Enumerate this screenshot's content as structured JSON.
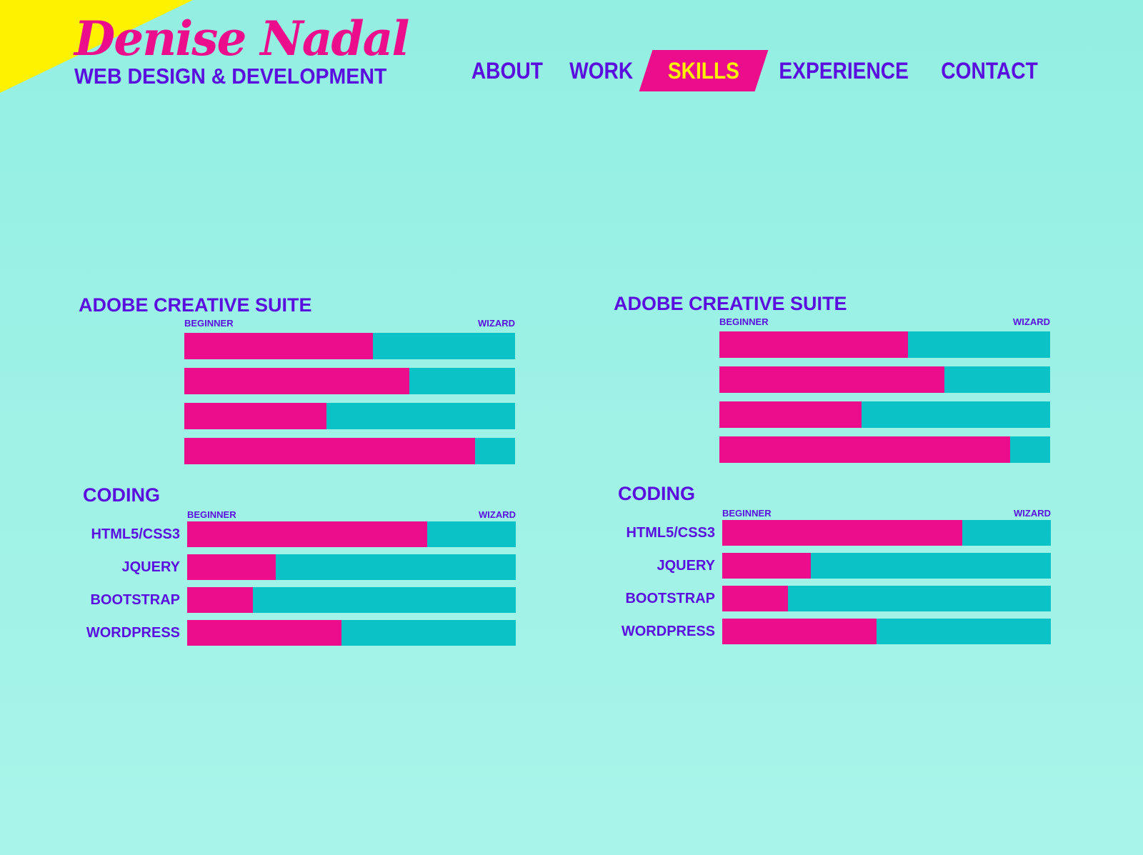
{
  "brand": {
    "name": "Denise Nadal",
    "tagline": "WEB DESIGN & DEVELOPMENT"
  },
  "nav": [
    {
      "label": "ABOUT",
      "active": false
    },
    {
      "label": "WORK",
      "active": false
    },
    {
      "label": "SKILLS",
      "active": true
    },
    {
      "label": "EXPERIENCE",
      "active": false
    },
    {
      "label": "CONTACT",
      "active": false
    }
  ],
  "colors": {
    "background": "#9ff1e6",
    "accent": "#ec0d8c",
    "text": "#5a0fde",
    "bar_track": "#0bc2c6",
    "highlight": "#fff200"
  },
  "panels": [
    {
      "adobe": {
        "title": "ADOBE CREATIVE SUITE",
        "scale_low": "BEGINNER",
        "scale_high": "WIZARD",
        "levels_percent": [
          57,
          68,
          43,
          88
        ]
      },
      "coding": {
        "title": "CODING",
        "scale_low": "BEGINNER",
        "scale_high": "WIZARD",
        "skills": [
          {
            "label": "HTML5/CSS3",
            "level_percent": 73
          },
          {
            "label": "JQUERY",
            "level_percent": 27
          },
          {
            "label": "BOOTSTRAP",
            "level_percent": 20
          },
          {
            "label": "WORDPRESS",
            "level_percent": 47
          }
        ]
      }
    },
    {
      "adobe": {
        "title": "ADOBE CREATIVE SUITE",
        "scale_low": "BEGINNER",
        "scale_high": "WIZARD",
        "levels_percent": [
          57,
          68,
          43,
          88
        ]
      },
      "coding": {
        "title": "CODING",
        "scale_low": "BEGINNER",
        "scale_high": "WIZARD",
        "skills": [
          {
            "label": "HTML5/CSS3",
            "level_percent": 73
          },
          {
            "label": "JQUERY",
            "level_percent": 27
          },
          {
            "label": "BOOTSTRAP",
            "level_percent": 20
          },
          {
            "label": "WORDPRESS",
            "level_percent": 47
          }
        ]
      }
    }
  ]
}
